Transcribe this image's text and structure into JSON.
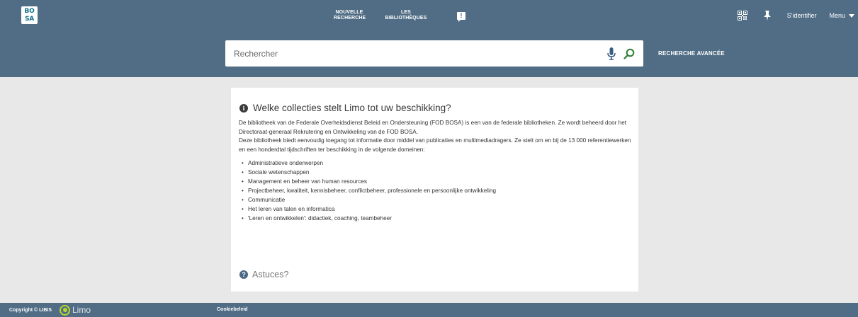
{
  "header": {
    "logo_lines": [
      "BO",
      "SA"
    ],
    "nav": {
      "new_search": "NOUVELLE RECHERCHE",
      "libraries": "LES BIBLIOTHÈQUES"
    },
    "signin": "S'identifier",
    "menu": "Menu"
  },
  "search": {
    "placeholder": "Rechercher",
    "advanced": "RECHERCHE AVANCÉE"
  },
  "card": {
    "title": "Welke collecties stelt Limo tot uw beschikking?",
    "paragraph1": "De bibliotheek van de Federale Overheidsdienst Beleid en Ondersteuning (FOD BOSA) is een van de federale bibliotheken. Ze wordt beheerd door het Directoraat-generaal Rekrutering en Ontwikkeling van de FOD BOSA.",
    "paragraph2": "Deze bibliotheek biedt eenvoudig toegang tot informatie door middel van publicaties en multimediadragers. Ze stelt om en bij de 13 000 referentiewerken en een honderdtal tijdschriften ter beschikking in de volgende domeinen:",
    "domains": [
      "Administratieve onderwerpen",
      "Sociale wetenschappen",
      "Management en beheer van human resources",
      "Projectbeheer, kwaliteit, kennisbeheer, conflictbeheer, professionele en persoonlijke ontwikkeling",
      "Communicatie",
      "Het leren van talen en informatica",
      "'Leren en ontwikkelen': didactiek, coaching, teambeheer"
    ],
    "tips": "Astuces?"
  },
  "footer": {
    "copyright": "Copyright © LIBIS",
    "limo": "Limo",
    "cookie": "Cookiebeleid"
  },
  "colors": {
    "header_bg": "#506d85",
    "page_bg": "#e8e8e8",
    "search_icon": "#2e7d32",
    "mic_icon": "#3a5f85",
    "limo_green": "#b7d52e"
  }
}
